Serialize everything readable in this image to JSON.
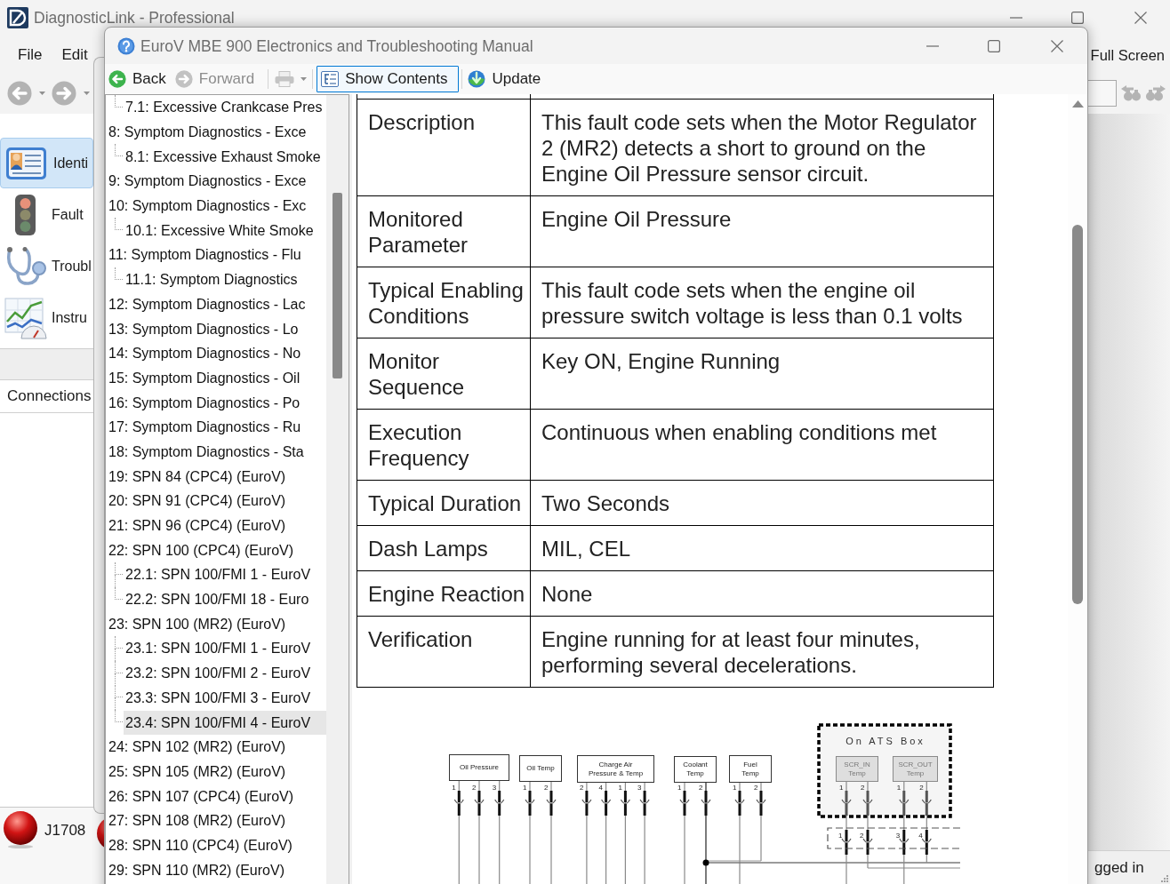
{
  "app_window": {
    "title": "DiagnosticLink - Professional",
    "menu_left": [
      "File",
      "Edit"
    ],
    "menu_right": [
      "Full Screen"
    ],
    "nav_buttons": [
      {
        "kind": "back",
        "disabled": true
      },
      {
        "kind": "forward",
        "disabled": true
      }
    ],
    "nav_items": [
      {
        "label": "Identi",
        "selected": true
      },
      {
        "label": "Fault",
        "selected": false
      },
      {
        "label": "Troubl",
        "selected": false
      },
      {
        "label": "Instru",
        "selected": false
      }
    ],
    "connections_header": "Connections",
    "connections": [
      {
        "label": "J1708",
        "connected": false
      },
      {
        "connected": false
      }
    ],
    "status_text": "gged in"
  },
  "manual_window": {
    "title": "EuroV MBE 900 Electronics and Troubleshooting Manual",
    "toolbar": [
      {
        "kind": "back",
        "label": "Back",
        "disabled": false,
        "pressed": false
      },
      {
        "kind": "forward",
        "label": "Forward",
        "disabled": true,
        "pressed": false
      },
      {
        "kind": "print",
        "disabled": true,
        "pressed": false
      },
      {
        "kind": "contents",
        "label": "Show Contents",
        "disabled": false,
        "pressed": true
      },
      {
        "kind": "update",
        "label": "Update",
        "disabled": false,
        "pressed": false
      }
    ],
    "contents_tree": [
      {
        "children": [
          {
            "label": "7.1: Excessive Crankcase Pres",
            "selected": false
          }
        ]
      },
      {
        "label": "8: Symptom Diagnostics - Exce",
        "selected": false,
        "children": [
          {
            "label": "8.1: Excessive Exhaust Smoke",
            "selected": false
          }
        ]
      },
      {
        "label": "9: Symptom Diagnostics - Exce",
        "selected": false
      },
      {
        "label": "10: Symptom Diagnostics - Exc",
        "selected": false,
        "children": [
          {
            "label": "10.1: Excessive White Smoke",
            "selected": false
          }
        ]
      },
      {
        "label": "11: Symptom Diagnostics - Flu",
        "selected": false,
        "children": [
          {
            "label": "11.1: Symptom Diagnostics",
            "selected": false
          }
        ]
      },
      {
        "label": "12: Symptom Diagnostics - Lac",
        "selected": false
      },
      {
        "label": "13: Symptom Diagnostics - Lo",
        "selected": false
      },
      {
        "label": "14: Symptom Diagnostics - No",
        "selected": false
      },
      {
        "label": "15: Symptom Diagnostics - Oil",
        "selected": false
      },
      {
        "label": "16: Symptom Diagnostics - Po",
        "selected": false
      },
      {
        "label": "17: Symptom Diagnostics - Ru",
        "selected": false
      },
      {
        "label": "18: Symptom Diagnostics - Sta",
        "selected": false
      },
      {
        "label": "19: SPN 84 (CPC4) (EuroV)",
        "selected": false
      },
      {
        "label": "20: SPN 91 (CPC4) (EuroV)",
        "selected": false
      },
      {
        "label": "21: SPN 96 (CPC4) (EuroV)",
        "selected": false
      },
      {
        "label": "22: SPN 100 (CPC4) (EuroV)",
        "selected": false,
        "children": [
          {
            "label": "22.1: SPN 100/FMI 1 - EuroV",
            "selected": false
          },
          {
            "label": "22.2: SPN 100/FMI 18 - Euro",
            "selected": false
          }
        ]
      },
      {
        "label": "23: SPN 100 (MR2) (EuroV)",
        "selected": false,
        "children": [
          {
            "label": "23.1: SPN 100/FMI 1 - EuroV",
            "selected": false
          },
          {
            "label": "23.2: SPN 100/FMI 2 - EuroV",
            "selected": false
          },
          {
            "label": "23.3: SPN 100/FMI 3 - EuroV",
            "selected": false
          },
          {
            "label": "23.4: SPN 100/FMI 4 - EuroV",
            "selected": true
          }
        ]
      },
      {
        "label": "24: SPN 102 (MR2) (EuroV)",
        "selected": false
      },
      {
        "label": "25: SPN 105 (MR2) (EuroV)",
        "selected": false
      },
      {
        "label": "26: SPN 107 (CPC4) (EuroV)",
        "selected": false
      },
      {
        "label": "27: SPN 108 (MR2) (EuroV)",
        "selected": false
      },
      {
        "label": "28: SPN 110 (CPC4) (EuroV)",
        "selected": false
      },
      {
        "label": "29: SPN 110 (MR2) (EuroV)",
        "selected": false
      }
    ],
    "fault_table": {
      "rows": [
        {
          "field": "Description",
          "value": "This fault code sets when the Motor Regulator 2 (MR2) detects a short to ground on the Engine Oil Pressure sensor circuit."
        },
        {
          "field": "Monitored Parameter",
          "value": "Engine Oil Pressure"
        },
        {
          "field": "Typical Enabling Conditions",
          "value": "This fault code sets when the engine oil pressure switch voltage is less than 0.1 volts"
        },
        {
          "field": "Monitor Sequence",
          "value": "Key ON, Engine Running"
        },
        {
          "field": "Execution Frequency",
          "value": "Continuous when enabling conditions met"
        },
        {
          "field": "Typical Duration",
          "value": "Two Seconds"
        },
        {
          "field": "Dash Lamps",
          "value": "MIL, CEL"
        },
        {
          "field": "Engine Reaction",
          "value": "None"
        },
        {
          "field": "Verification",
          "value": "Engine running for at least four minutes, performing several decelerations."
        }
      ]
    },
    "wiring_diagram": {
      "sensors": [
        {
          "label": "Oil Pressure",
          "pins": [
            "1",
            "2",
            "3"
          ]
        },
        {
          "label": "Oil Temp",
          "pins": [
            "1",
            "2"
          ]
        },
        {
          "label": "Charge Air Pressure & Temp",
          "pins": [
            "2",
            "4",
            "1",
            "3"
          ]
        },
        {
          "label": "Coolant Temp",
          "pins": [
            "1",
            "2"
          ]
        },
        {
          "label": "Fuel Temp",
          "pins": [
            "1",
            "2"
          ]
        }
      ],
      "ats_box": {
        "title": "On ATS Box",
        "sensors": [
          {
            "label": "SCR_IN Temp",
            "pins": [
              "1",
              "2"
            ]
          },
          {
            "label": "SCR_OUT Temp",
            "pins": [
              "1",
              "2"
            ]
          }
        ]
      },
      "connector_pins": [
        "1",
        "2",
        "3",
        "4"
      ]
    }
  }
}
